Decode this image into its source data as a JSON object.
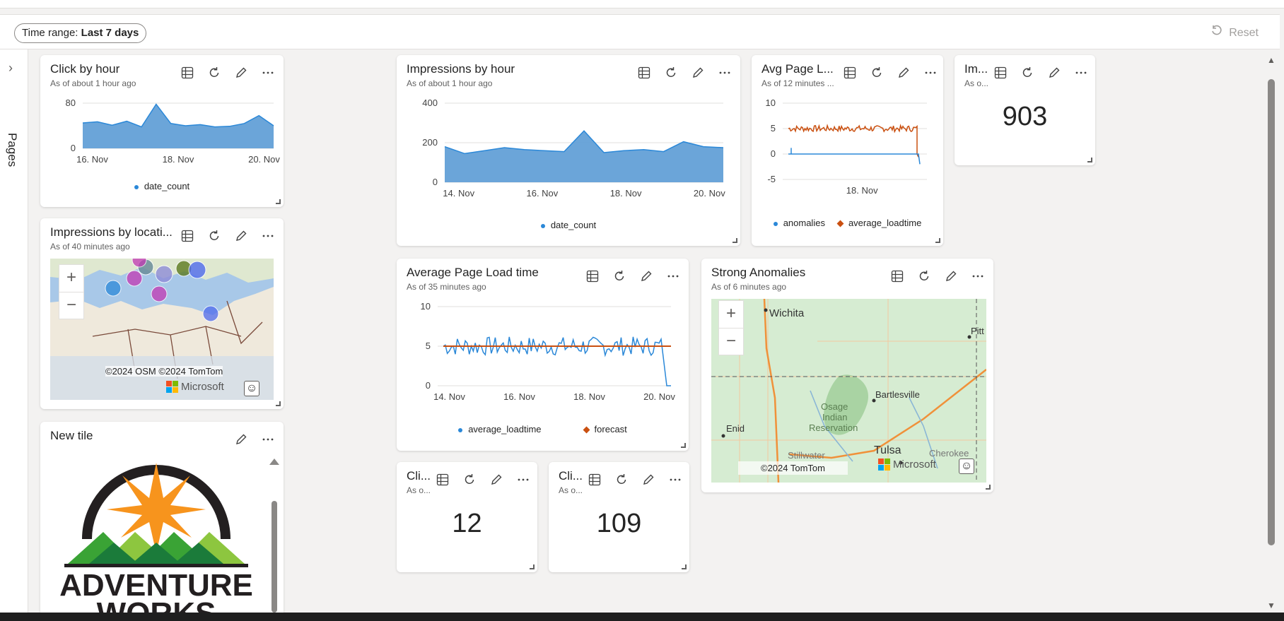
{
  "toolbar": {
    "time_range_label": "Time range:",
    "time_range_value": "Last 7 days",
    "reset_label": "Reset"
  },
  "pages_rail": {
    "label": "Pages"
  },
  "tiles": {
    "click_by_hour": {
      "title": "Click by hour",
      "subtitle": "As of about 1 hour ago"
    },
    "impressions_by_hour": {
      "title": "Impressions by hour",
      "subtitle": "As of about 1 hour ago"
    },
    "avg_page_load": {
      "title": "Avg Page L...",
      "subtitle": "As of 12 minutes ..."
    },
    "im_stat": {
      "title": "Im...",
      "subtitle": "As o...",
      "value": "903"
    },
    "impressions_by_location": {
      "title": "Impressions by locati...",
      "subtitle": "As of 40 minutes ago",
      "copyright": "©2024 OSM  ©2024 TomTom",
      "brand": "Microsoft"
    },
    "average_page_load_time": {
      "title": "Average Page Load time",
      "subtitle": "As of 35 minutes ago"
    },
    "strong_anomalies": {
      "title": "Strong Anomalies",
      "subtitle": "As of 6 minutes ago",
      "copyright": "©2024 TomTom",
      "brand": "Microsoft",
      "places": [
        "Wichita",
        "Pitt",
        "Bartlesville",
        "Osage",
        "Indian",
        "Reservation",
        "Enid",
        "Stillwater",
        "Tulsa",
        "Cherokee"
      ]
    },
    "new_tile": {
      "title": "New tile",
      "logo_text_1": "ADVENTURE",
      "logo_text_2": "WORKS"
    },
    "cli_stat_1": {
      "title": "Cli...",
      "subtitle": "As o...",
      "value": "12"
    },
    "cli_stat_2": {
      "title": "Cli...",
      "subtitle": "As o...",
      "value": "109"
    }
  },
  "chart_data": [
    {
      "id": "click_by_hour",
      "type": "area",
      "x": [
        "15. Nov",
        "15.5 Nov",
        "16. Nov",
        "16.5 Nov",
        "17. Nov",
        "17.3 Nov",
        "17.5 Nov",
        "18. Nov",
        "18.5 Nov",
        "19. Nov",
        "19.5 Nov",
        "20. Nov",
        "20.3 Nov",
        "20.7 Nov"
      ],
      "series": [
        {
          "name": "date_count",
          "values": [
            45,
            47,
            41,
            48,
            38,
            78,
            44,
            40,
            42,
            38,
            39,
            44,
            58,
            40
          ]
        }
      ],
      "x_ticks": [
        "16. Nov",
        "18. Nov",
        "20. Nov"
      ],
      "y_ticks": [
        "0",
        "80"
      ],
      "ylim": [
        0,
        80
      ],
      "color": "#5b9bd5"
    },
    {
      "id": "impressions_by_hour",
      "type": "area",
      "x": [
        "14. Nov",
        "14.5 Nov",
        "15. Nov",
        "15.5 Nov",
        "16. Nov",
        "16.5 Nov",
        "17. Nov",
        "17.2 Nov",
        "17.5 Nov",
        "18. Nov",
        "18.5 Nov",
        "19. Nov",
        "19.5 Nov",
        "20. Nov",
        "20.5 Nov"
      ],
      "series": [
        {
          "name": "date_count",
          "values": [
            180,
            145,
            160,
            175,
            165,
            160,
            155,
            260,
            150,
            160,
            165,
            155,
            205,
            180,
            175
          ]
        }
      ],
      "x_ticks": [
        "14. Nov",
        "16. Nov",
        "18. Nov",
        "20. Nov"
      ],
      "y_ticks": [
        "0",
        "200",
        "400"
      ],
      "ylim": [
        0,
        400
      ],
      "color": "#5b9bd5"
    },
    {
      "id": "avg_page_load",
      "type": "line",
      "series": [
        {
          "name": "anomalies",
          "color": "#2b88d8"
        },
        {
          "name": "average_loadtime",
          "color": "#ca5010"
        }
      ],
      "x_ticks": [
        "18. Nov"
      ],
      "y_ticks": [
        "-5",
        "0",
        "5",
        "10"
      ],
      "ylim": [
        -5,
        10
      ]
    },
    {
      "id": "average_page_load_time",
      "type": "line",
      "series": [
        {
          "name": "average_loadtime",
          "color": "#2b88d8"
        },
        {
          "name": "forecast",
          "color": "#ca5010"
        }
      ],
      "x_ticks": [
        "14. Nov",
        "16. Nov",
        "18. Nov",
        "20. Nov"
      ],
      "y_ticks": [
        "0",
        "5",
        "10"
      ],
      "ylim": [
        0,
        10
      ]
    }
  ]
}
